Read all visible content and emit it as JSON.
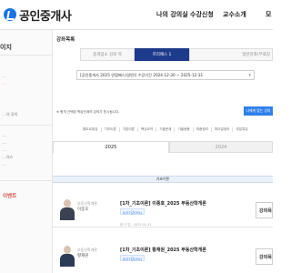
{
  "header": {
    "logo_text": "공인중개사",
    "nav": [
      "나의 강의실",
      "수강신청",
      "교수소개",
      "모"
    ]
  },
  "sidebar": {
    "title": "이지",
    "items": [
      {
        "label": "…",
        "active": false
      },
      {
        "label": "…",
        "active": true
      },
      {
        "label": "…의 강의",
        "active": false
      },
      {
        "label": "…",
        "active": false
      },
      {
        "label": "…",
        "active": false
      },
      {
        "label": "…",
        "active": false
      },
      {
        "label": "…의스",
        "active": false
      },
      {
        "label": "…",
        "active": false
      }
    ],
    "event_label": "이벤트"
  },
  "main": {
    "heading": "강좌목록",
    "tabs": [
      "종개업소 강의 목",
      "프리패스 1",
      "일반강좌(무료강"
    ],
    "package_select": "[공인중개사 2025 연합패스(일반)] 수강기간 2024-12-30 ~ 2025-12-31",
    "notice": "※ 원격 선택된 학습단계의 강의가 표시됩니다.",
    "view_button": "나에게 맞는 강의",
    "categories": [
      "맵트르정강",
      "기초이론",
      "기본이론",
      "핵심요약",
      "기출문제",
      "기출응용",
      "최종정리",
      "파이널정리",
      "부분특강"
    ],
    "year_tabs": [
      {
        "label": "2025",
        "active": true
      },
      {
        "label": "2024",
        "active": false
      }
    ],
    "section_label": "기초이론",
    "lectures": [
      {
        "subject": "부동산학개론",
        "teacher": "이종호",
        "title": "[1차_기초이론] 이종호_2025 부동산학개론",
        "badge": "0/27강(0%)",
        "meta": "총 27강 · 2025.01.31",
        "button": "강의목"
      },
      {
        "subject": "부동산학개론",
        "teacher": "황재원",
        "title": "[1차_기초이론] 황재원_2025 부동산학개론",
        "badge": "0/27강(0%)",
        "meta": "",
        "button": "강의목"
      }
    ]
  }
}
